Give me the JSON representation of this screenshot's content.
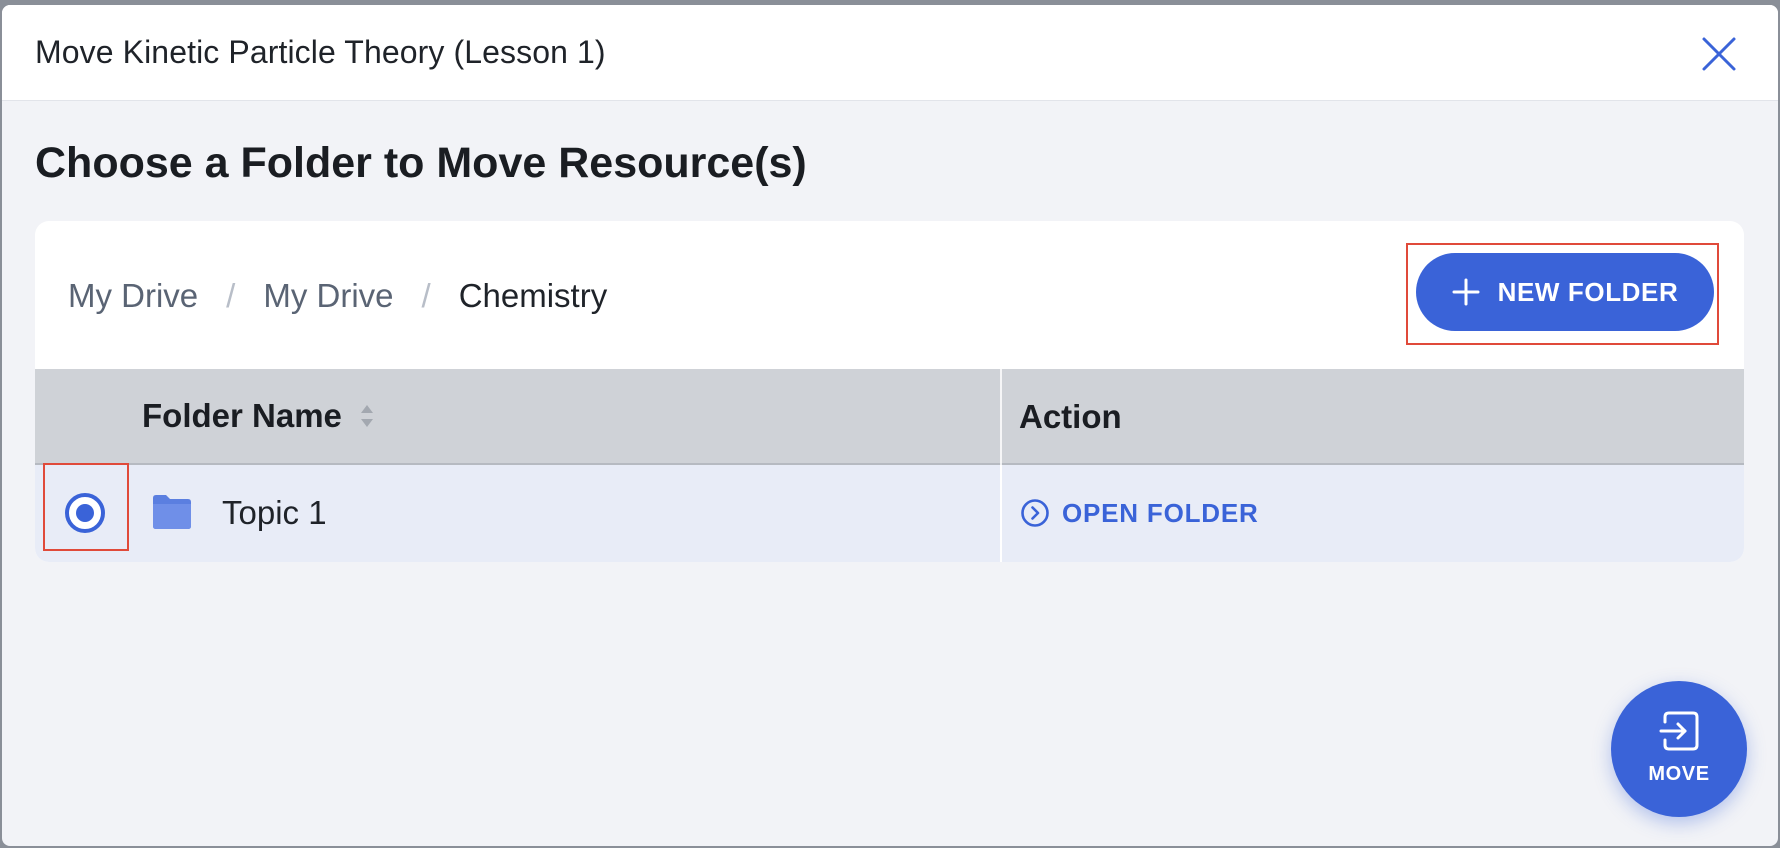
{
  "modal": {
    "title": "Move Kinetic Particle Theory (Lesson 1)"
  },
  "heading": "Choose a Folder to Move Resource(s)",
  "breadcrumb": {
    "items": [
      "My Drive",
      "My Drive",
      "Chemistry"
    ],
    "separator": "/"
  },
  "toolbar": {
    "new_folder_label": "NEW FOLDER"
  },
  "table": {
    "columns": [
      "Folder Name",
      "Action"
    ],
    "rows": [
      {
        "name": "Topic 1",
        "action_label": "OPEN FOLDER",
        "selected": true
      }
    ]
  },
  "move_button": {
    "label": "MOVE"
  },
  "icons": {
    "close": "close-icon",
    "plus": "plus-icon",
    "sort": "sort-icon",
    "folder": "folder-icon",
    "chevron": "chevron-right-circle-icon",
    "move": "move-icon"
  },
  "colors": {
    "accent": "#3a63d8",
    "highlight": "#e04a3a",
    "row_selected": "#e8ecf7",
    "header_bg": "#cfd2d7"
  }
}
